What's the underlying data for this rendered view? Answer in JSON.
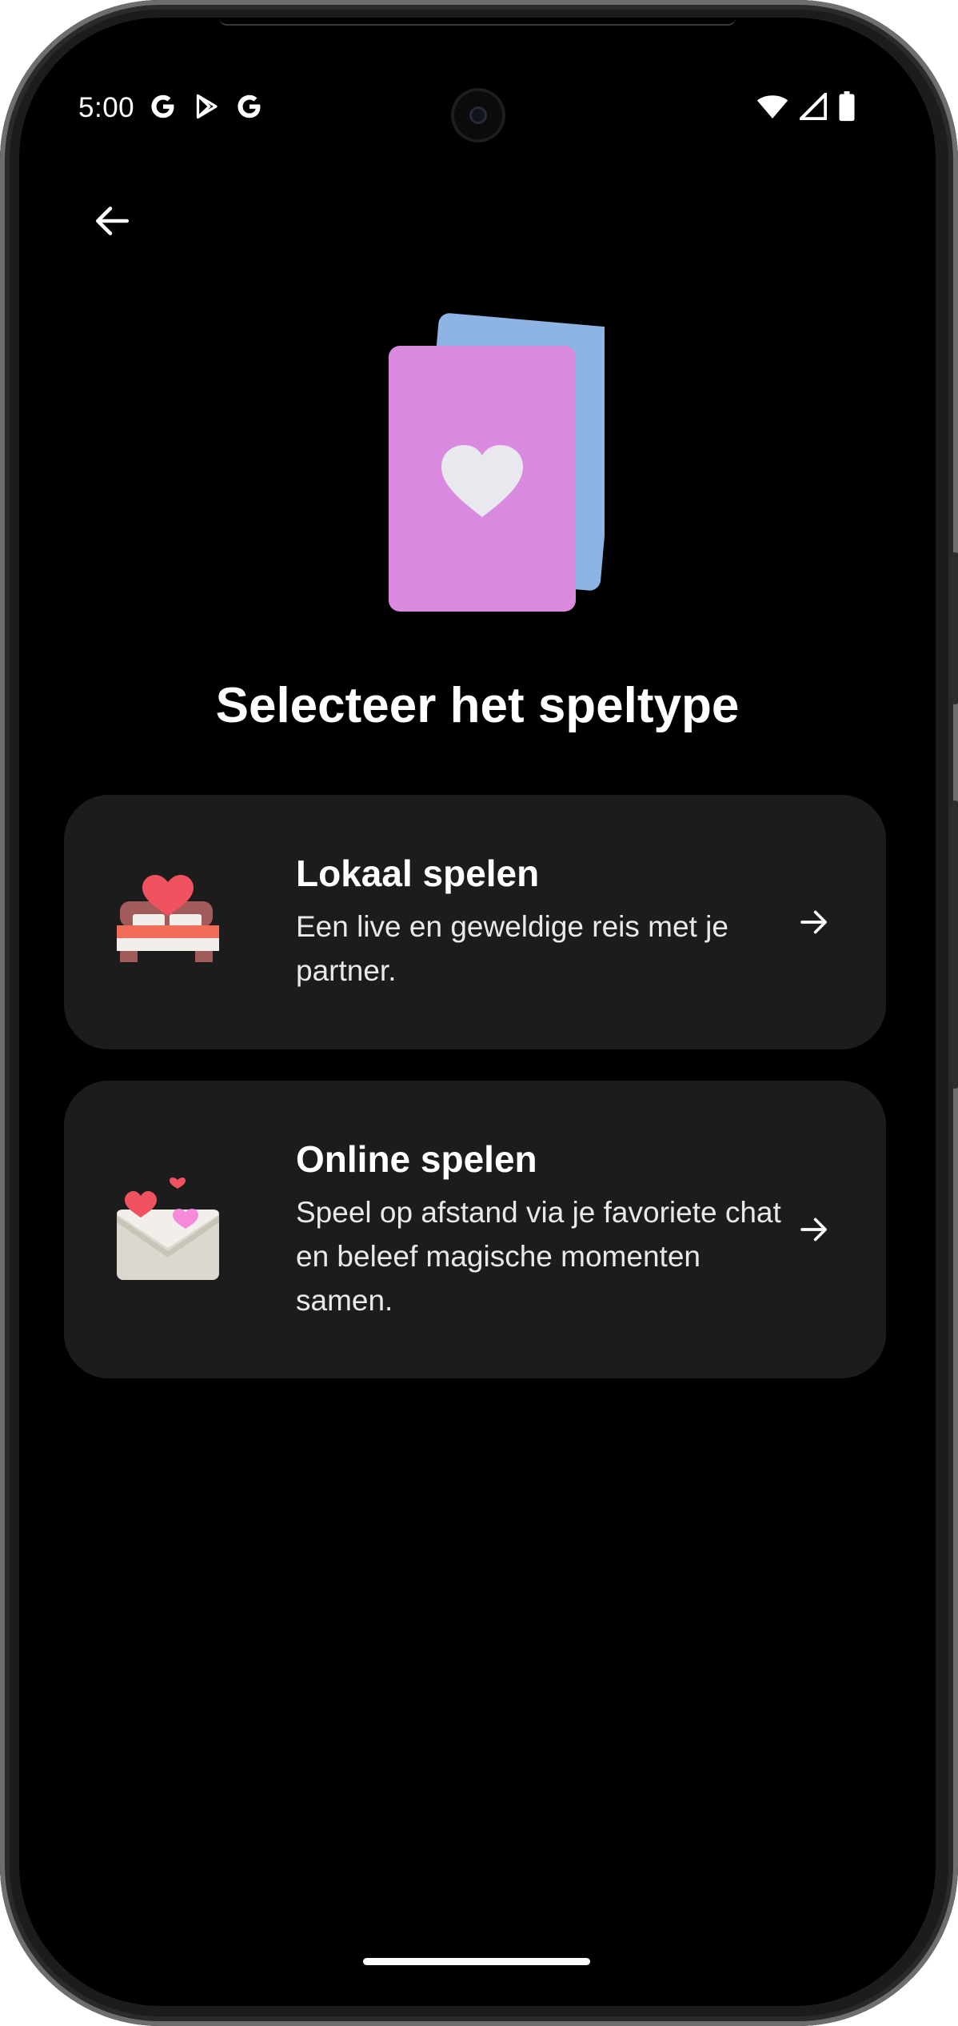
{
  "status_bar": {
    "time": "5:00",
    "notification_icons": [
      "google-icon",
      "play-store-icon",
      "google-icon"
    ],
    "system_icons": [
      "wifi-icon",
      "signal-icon",
      "battery-icon"
    ]
  },
  "nav": {
    "back_icon": "arrow-left-icon"
  },
  "hero": {
    "icon": "playing-cards-heart-icon",
    "colors": {
      "front_card": "#D98ADF",
      "back_card": "#8EB4E3",
      "heart": "#E8E8EE"
    }
  },
  "page_title": "Selecteer het speltype",
  "options": [
    {
      "title": "Lokaal spelen",
      "description": "Een live en geweldige reis met je partner.",
      "icon": "bed-with-heart-icon",
      "arrow_icon": "arrow-right-icon"
    },
    {
      "title": "Online spelen",
      "description": "Speel op afstand via je favoriete chat en beleef magische momenten samen.",
      "icon": "love-letter-icon",
      "arrow_icon": "arrow-right-icon"
    }
  ],
  "theme": {
    "background": "#000000",
    "card": "#1C1C1C",
    "text": "#FFFFFF"
  }
}
